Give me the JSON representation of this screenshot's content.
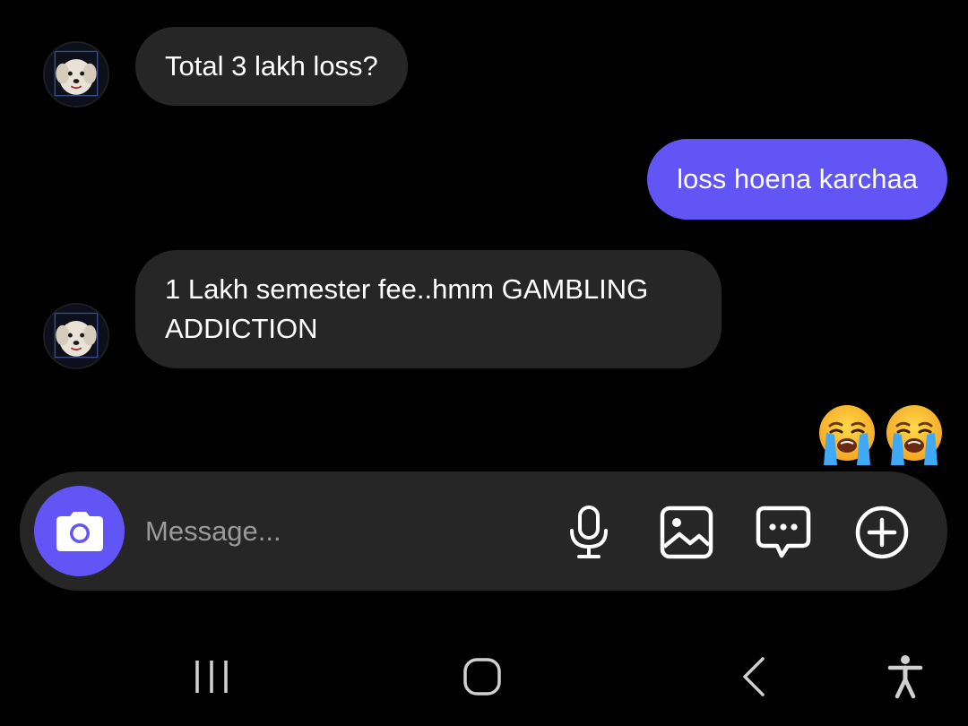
{
  "messages": [
    {
      "direction": "incoming",
      "text": "Total 3 lakh loss?"
    },
    {
      "direction": "outgoing",
      "text": "loss hoena karchaa"
    },
    {
      "direction": "incoming",
      "text": "1 Lakh semester fee..hmm GAMBLING ADDICTION"
    }
  ],
  "reaction": {
    "emoji": "loudly-crying-face",
    "count": 2
  },
  "composer": {
    "placeholder": "Message...",
    "value": "",
    "actions": [
      "camera-icon",
      "microphone-icon",
      "gallery-icon",
      "sticker-icon",
      "plus-icon"
    ]
  },
  "navigation": [
    "recent-apps-icon",
    "home-icon",
    "back-icon",
    "accessibility-icon"
  ],
  "colors": {
    "background": "#000000",
    "incoming_bubble": "#262626",
    "outgoing_bubble": "#6155f6",
    "composer": "#262626",
    "accent": "#6155f6",
    "placeholder": "#9a9a9a"
  }
}
